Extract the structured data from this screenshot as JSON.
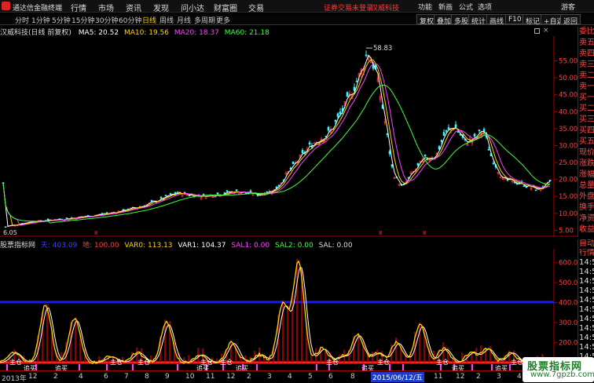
{
  "topbar": {
    "app_title": "通达信金融终端",
    "menus": [
      "行情",
      "市场",
      "资讯",
      "发现",
      "问小达",
      "财富圈",
      "交易"
    ],
    "notice": "证券交易未登录",
    "stock_link": "汉威科技",
    "right_items": [
      "功能",
      "新画",
      "公式",
      "选项",
      "游客"
    ]
  },
  "period": {
    "items": [
      "分时",
      "1分钟",
      "5分钟",
      "15分钟",
      "30分钟",
      "60分钟",
      "日线",
      "周线",
      "月线",
      "多周期",
      "更多"
    ],
    "active": "日线",
    "tools": [
      "复权",
      "叠加",
      "多股",
      "统计",
      "画线",
      "F10",
      "标记",
      "+自选",
      "返回"
    ]
  },
  "main_chart": {
    "stock_label": "汉威科技(日线 前复权)",
    "indicators": [
      {
        "label": "MA5: 20.52",
        "color": "#ffffff"
      },
      {
        "label": "MA10: 19.56",
        "color": "#ffd400"
      },
      {
        "label": "MA20: 18.37",
        "color": "#ff40ff"
      },
      {
        "label": "MA60: 21.18",
        "color": "#40ff40"
      }
    ],
    "peak_label": "58.83",
    "low_label": "6.05",
    "y_ticks": [
      "55.00",
      "50.00",
      "45.00",
      "40.00",
      "35.00",
      "30.00",
      "25.00",
      "20.00",
      "15.00",
      "10.00",
      "5.00"
    ]
  },
  "indicator_panel": {
    "name": "股票指标网",
    "values": [
      {
        "label": "天: 403.09",
        "color": "#4040ff"
      },
      {
        "label": "地: 100.00",
        "color": "#ff4040"
      },
      {
        "label": "VAR0: 113.13",
        "color": "#ffd400"
      },
      {
        "label": "VAR1: 104.37",
        "color": "#ffffff"
      },
      {
        "label": "SAL1: 0.00",
        "color": "#ff40ff"
      },
      {
        "label": "SAL2: 0.00",
        "color": "#40ff40"
      },
      {
        "label": "SAL: 0.00",
        "color": "#dddddd"
      }
    ],
    "y_ticks": [
      "600.0",
      "500.0",
      "400.0",
      "300.0",
      "200.0",
      "100.0"
    ],
    "buy_label": "追买",
    "sell_label": "主仓"
  },
  "side_panel_top": [
    "委比",
    "卖五",
    "卖四",
    "卖三",
    "卖二",
    "卖一",
    "买一",
    "买二",
    "买三",
    "买四",
    "买五",
    "现价",
    "涨跌",
    "涨幅",
    "总量",
    "外盘",
    "换手",
    "净资",
    "收益"
  ],
  "side_panel_bottom": [
    "自动",
    "行情",
    "14:5",
    "14:5",
    "14:5",
    "14:5",
    "14:5",
    "14:5",
    "14:5",
    "14:5",
    "14:5",
    "14:5",
    "14:5",
    "14:5"
  ],
  "bottom_axis": {
    "labels": [
      "2013年",
      "12",
      "2",
      "4",
      "6",
      "7",
      "8",
      "9",
      "10",
      "11",
      "12",
      "2",
      "3",
      "4",
      "5",
      "6",
      "8",
      "9",
      "10",
      "11",
      "12",
      "2",
      "3",
      "4",
      "5"
    ],
    "highlight": "2015/06/12/五"
  },
  "watermark": {
    "title": "股票指标网",
    "url": "www.7gpzb.com"
  },
  "colors": {
    "up": "#ff3030",
    "down": "#30ffff",
    "ma5": "#ffffff",
    "ma10": "#ffd400",
    "ma20": "#ff40ff",
    "ma60": "#40ff40",
    "sky_line": "#1a1aff",
    "ground_line": "#ff2020",
    "border": "#aa0000"
  }
}
